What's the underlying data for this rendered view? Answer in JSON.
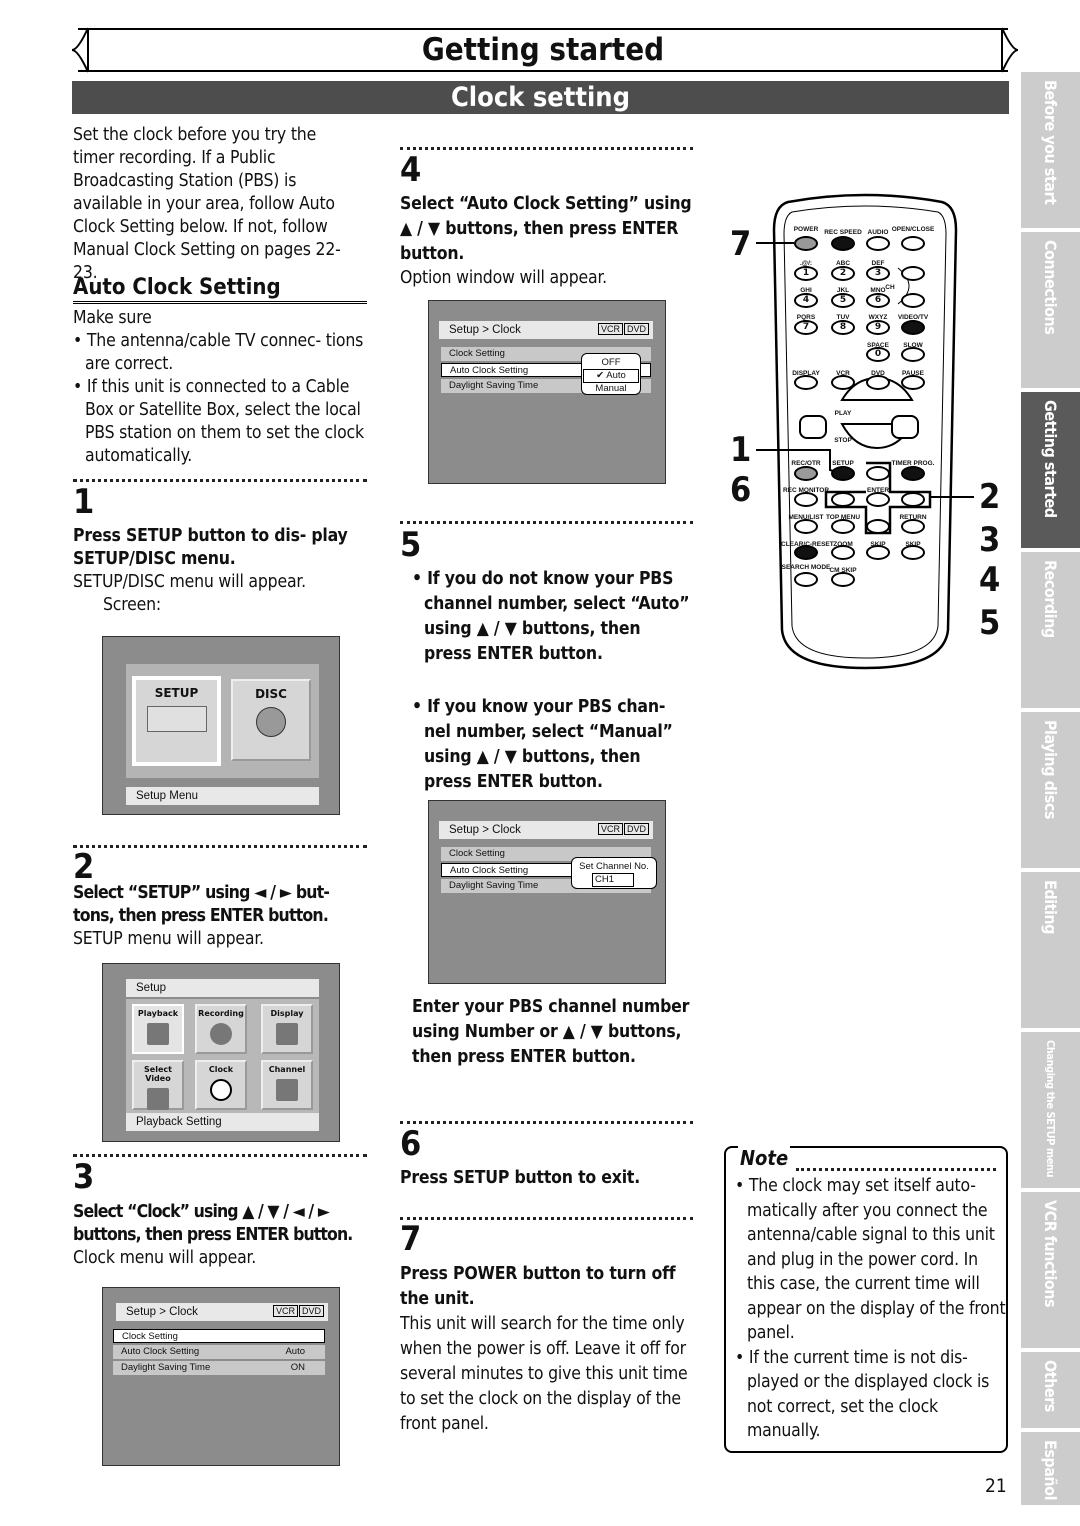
{
  "header": {
    "title": "Getting started",
    "section": "Clock setting"
  },
  "side_tabs": [
    {
      "label": "Before you start",
      "active": false
    },
    {
      "label": "Connections",
      "active": false
    },
    {
      "label": "Getting started",
      "active": true
    },
    {
      "label": "Recording",
      "active": false
    },
    {
      "label": "Playing discs",
      "active": false
    },
    {
      "label": "Editing",
      "active": false
    },
    {
      "label": "Changing the SETUP menu",
      "active": false
    },
    {
      "label": "VCR functions",
      "active": false
    },
    {
      "label": "Others",
      "active": false
    },
    {
      "label": "Español",
      "active": false
    }
  ],
  "intro": "Set the clock before you try the timer recording. If a Public Broadcasting Station (PBS) is available in your area, follow Auto Clock Setting below. If not, follow Manual Clock Setting on pages 22-23.",
  "auto_clock": {
    "heading": "Auto Clock Setting",
    "make_sure": "Make sure",
    "bullets": [
      "• The antenna/cable TV connec- tions are correct.",
      "• If this unit is connected to a Cable Box or Satellite Box, select the local PBS station on them to set the clock automatically."
    ]
  },
  "steps": {
    "s1": {
      "num": "1",
      "instruction": "Press SETUP button to dis- play SETUP/DISC menu.",
      "result": "SETUP/DISC menu will appear.",
      "screen_label": "Screen:"
    },
    "s2": {
      "num": "2",
      "instruction": "Select “SETUP” using ◄ / ► but- tons, then press ENTER button.",
      "result": "SETUP menu will appear."
    },
    "s3": {
      "num": "3",
      "instruction": "Select “Clock” using ▲ / ▼ / ◄ / ► buttons, then press ENTER button.",
      "result": "Clock menu will appear."
    },
    "s4": {
      "num": "4",
      "instruction": "Select “Auto Clock Setting” using ▲ / ▼ buttons, then press ENTER button.",
      "result": "Option window will appear."
    },
    "s5": {
      "num": "5",
      "bullet1": "• If you do not know your PBS channel number, select “Auto” using ▲ / ▼ buttons, then press ENTER button.",
      "bullet2": "• If you know your PBS chan- nel number, select “Manual” using ▲ / ▼ buttons, then press ENTER button.",
      "after": "Enter your PBS channel number using Number or ▲ / ▼ buttons, then press ENTER button."
    },
    "s6": {
      "num": "6",
      "instruction": "Press SETUP button to exit."
    },
    "s7": {
      "num": "7",
      "instruction": "Press POWER button to turn off the unit.",
      "result": "This unit will search for the time only when the power is off. Leave it off for several minutes to give this unit time to set the clock on the display of the front panel."
    }
  },
  "screens": {
    "setup_disc": {
      "setup": "SETUP",
      "disc": "DISC",
      "footer": "Setup Menu"
    },
    "setup_menu": {
      "title": "Setup",
      "tiles": [
        "Playback",
        "Recording",
        "Display",
        "Select Video",
        "Clock",
        "Channel"
      ],
      "footer": "Playback Setting"
    },
    "clock": {
      "breadcrumb": "Setup > Clock",
      "vcr": "VCR",
      "dvd": "DVD",
      "rows": [
        "Clock Setting",
        "Auto Clock Setting",
        "Daylight Saving Time"
      ],
      "values": [
        "",
        "Auto",
        "ON"
      ]
    },
    "option": {
      "options": [
        "OFF",
        "Auto",
        "Manual"
      ],
      "checked": "✔"
    },
    "channel": {
      "title": "Set Channel No.",
      "value": "CH1"
    }
  },
  "remote": {
    "buttons": [
      "POWER",
      "REC SPEED",
      "AUDIO",
      "OPEN/CLOSE",
      ".@/:",
      "ABC",
      "DEF",
      "GHI",
      "JKL",
      "MNO",
      "PQRS",
      "TUV",
      "WXYZ",
      "VIDEO/TV",
      "SPACE",
      "SLOW",
      "DISPLAY",
      "VCR",
      "DVD",
      "PAUSE",
      "REC/OTR",
      "SETUP",
      "TIMER PROG.",
      "REC MONITOR",
      "ENTER",
      "MENU/LIST",
      "TOP MENU",
      "RETURN",
      "CLEAR/C-RESET",
      "ZOOM",
      "SKIP",
      "SKIP",
      "SEARCH MODE",
      "CM SKIP",
      "PLAY",
      "STOP",
      "CH"
    ],
    "digits": [
      "1",
      "2",
      "3",
      "4",
      "5",
      "6",
      "7",
      "8",
      "9",
      "0"
    ],
    "callouts_left": [
      "7",
      "1",
      "6"
    ],
    "callouts_right": [
      "2",
      "3",
      "4",
      "5"
    ]
  },
  "note": {
    "title": "Note",
    "bullets": [
      "• The clock may set itself auto- matically after you connect the antenna/cable signal to this unit and plug in the power cord. In this case, the current time will appear on the display of the front panel.",
      "• If the current time is not dis- played or the displayed clock is not correct, set the clock manually."
    ]
  },
  "page_number": "21"
}
